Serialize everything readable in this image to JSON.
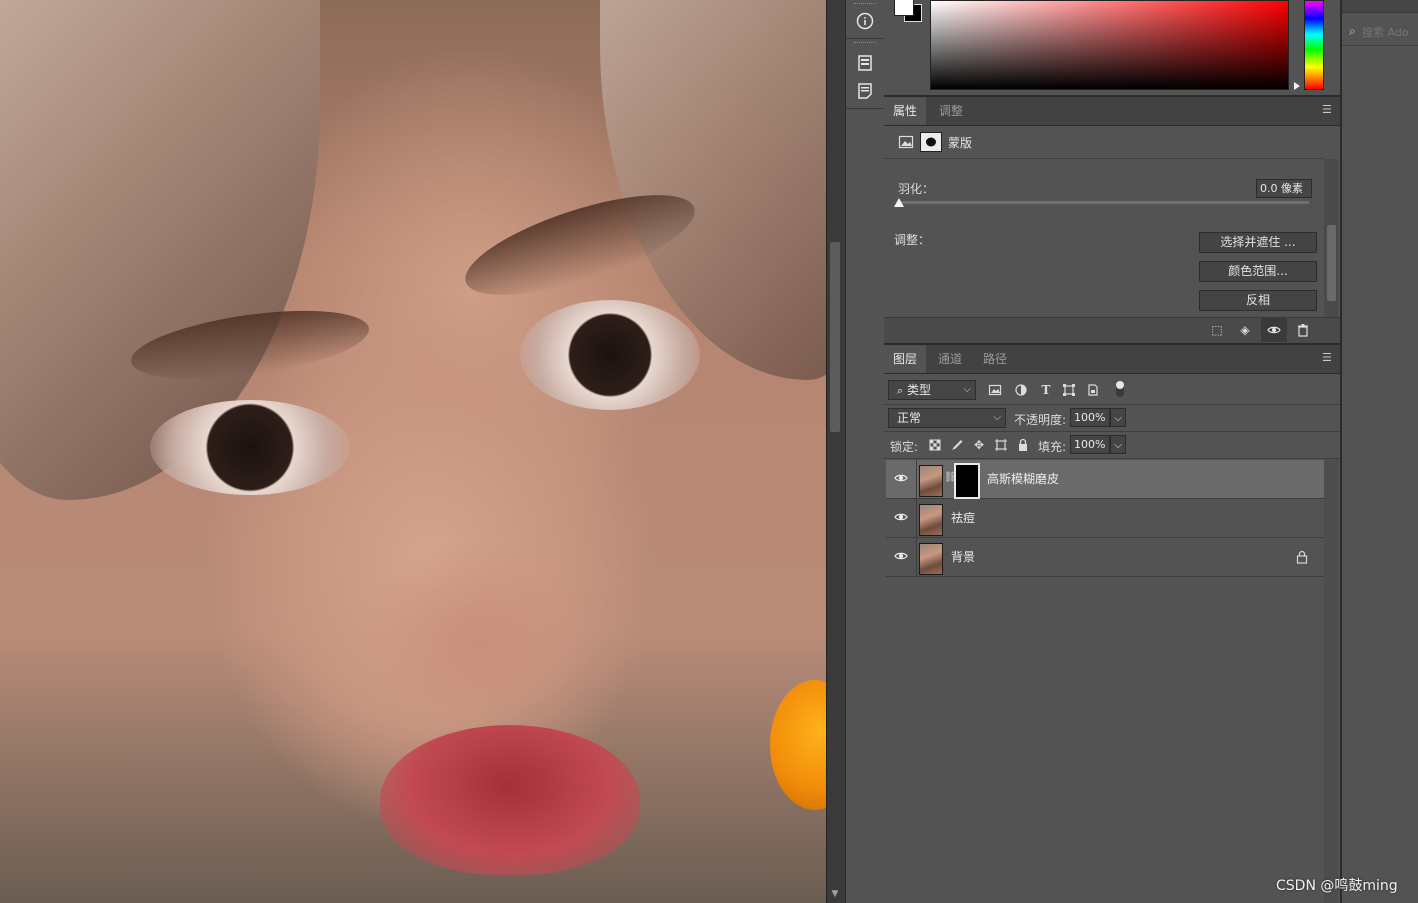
{
  "properties_panel": {
    "tabs": [
      "属性",
      "调整"
    ],
    "active_tab": "属性",
    "mask_label": "蒙版",
    "feather_label": "羽化：",
    "feather_value": "0.0 像素",
    "adjust_label": "调整：",
    "buttons": [
      "选择并遮住 ...",
      "颜色范围...",
      "反相"
    ]
  },
  "layers_panel": {
    "tabs": [
      "图层",
      "通道",
      "路径"
    ],
    "active_tab": "图层",
    "filter_kind": "类型",
    "blend_mode": "正常",
    "opacity_label": "不透明度:",
    "opacity_value": "100%",
    "lock_label": "锁定:",
    "fill_label": "填充:",
    "fill_value": "100%",
    "layers": [
      {
        "name": "高斯模糊磨皮",
        "selected": true,
        "has_mask": true,
        "locked": false,
        "visible": true
      },
      {
        "name": "祛痘",
        "selected": false,
        "has_mask": false,
        "locked": false,
        "visible": true
      },
      {
        "name": "背景",
        "selected": false,
        "has_mask": false,
        "locked": true,
        "visible": true
      }
    ]
  },
  "search": {
    "placeholder": "搜索 Ado"
  },
  "watermark": "CSDN @鸣鼓ming",
  "colors": {
    "panel_bg": "#535353",
    "tabbar_bg": "#424242",
    "selected_layer": "#6a6a6a",
    "foreground_swatch": "#ffffff",
    "background_swatch": "#000000"
  },
  "icons": [
    "info-icon",
    "document-icon",
    "notes-icon",
    "search-icon",
    "menu-icon",
    "image-filter-icon",
    "adjustment-filter-icon",
    "type-filter-icon",
    "shape-filter-icon",
    "smart-object-filter-icon",
    "eye-icon",
    "link-icon",
    "lock-icon",
    "trash-icon"
  ]
}
